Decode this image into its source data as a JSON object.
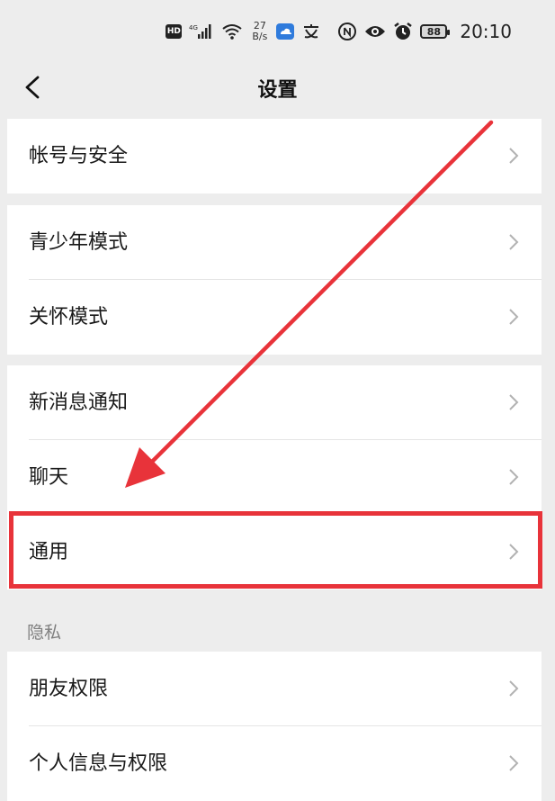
{
  "status_bar": {
    "hd_badge": "HD",
    "network": "4G",
    "net_speed_value": "27",
    "net_speed_unit": "B/s",
    "battery": "88",
    "time": "20:10",
    "icons": [
      "hd-icon",
      "signal-icon",
      "wifi-icon",
      "weather-icon",
      "translate-icon",
      "nfc-icon",
      "eye-icon",
      "alarm-icon",
      "battery-icon"
    ]
  },
  "nav": {
    "back_icon": "chevron-left-icon",
    "title": "设置"
  },
  "groups": [
    {
      "items": [
        {
          "label": "帐号与安全"
        }
      ]
    },
    {
      "items": [
        {
          "label": "青少年模式"
        },
        {
          "label": "关怀模式"
        }
      ]
    },
    {
      "items": [
        {
          "label": "新消息通知"
        },
        {
          "label": "聊天"
        },
        {
          "label": "通用"
        }
      ]
    },
    {
      "header": "隐私",
      "items": [
        {
          "label": "朋友权限"
        },
        {
          "label": "个人信息与权限"
        }
      ]
    }
  ],
  "annotation": {
    "highlighted_item": "通用",
    "color": "#e8333a"
  },
  "colors": {
    "background": "#ededed",
    "card": "#ffffff",
    "text": "#191919",
    "secondary_text": "#7f7f7f",
    "chevron": "#b2b2b2",
    "annotation_red": "#e8333a"
  }
}
